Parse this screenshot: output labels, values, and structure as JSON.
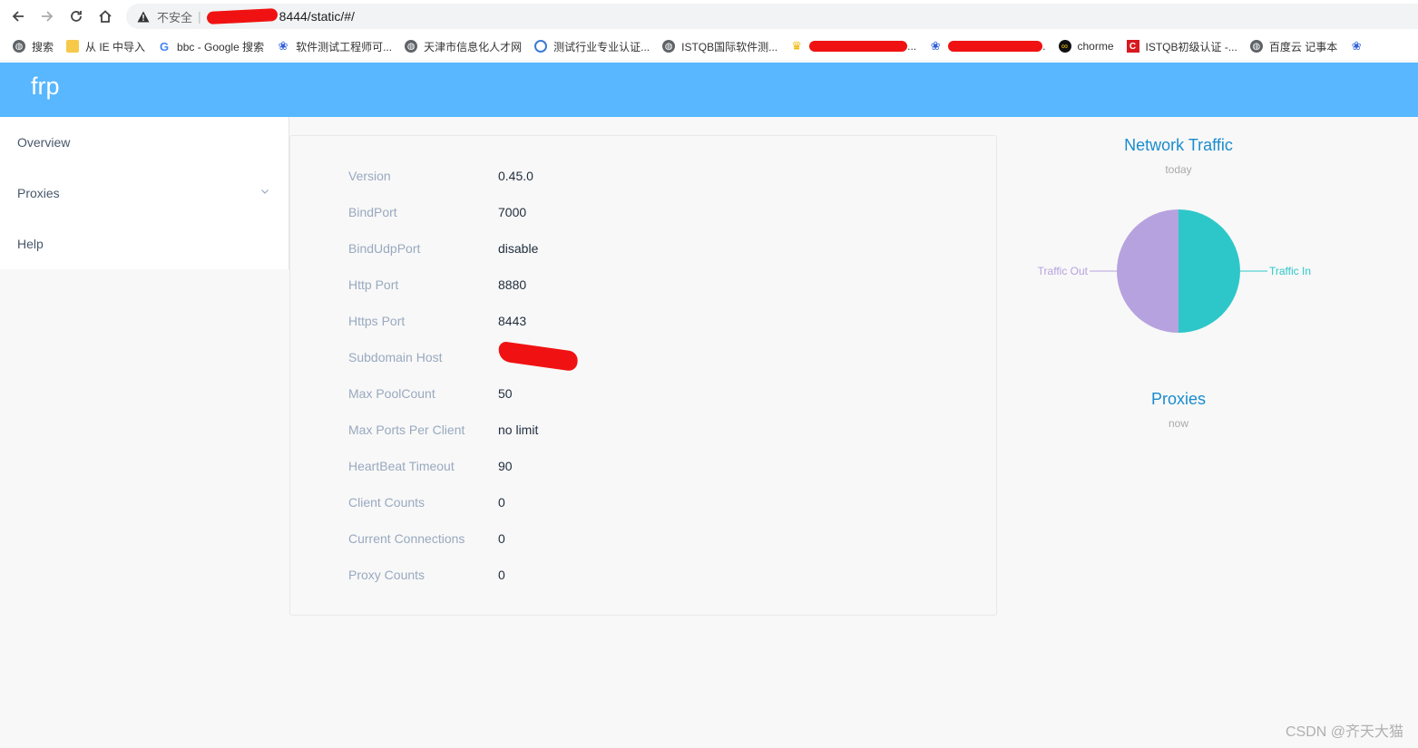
{
  "browser": {
    "insecure_label": "不安全",
    "url_visible": "8444/static/#/",
    "bookmarks": [
      "搜索",
      "从 IE 中导入",
      "bbc - Google 搜索",
      "软件测试工程师可...",
      "天津市信息化人才网",
      "测试行业专业认证...",
      "ISTQB国际软件测...",
      "...",
      ".",
      "chorme",
      "ISTQB初级认证 -...",
      "百度云 记事本"
    ]
  },
  "app": {
    "logo": "frp"
  },
  "sidebar": {
    "items": [
      {
        "label": "Overview"
      },
      {
        "label": "Proxies"
      },
      {
        "label": "Help"
      }
    ]
  },
  "server_info": [
    {
      "key": "Version",
      "value": "0.45.0"
    },
    {
      "key": "BindPort",
      "value": "7000"
    },
    {
      "key": "BindUdpPort",
      "value": "disable"
    },
    {
      "key": "Http Port",
      "value": "8880"
    },
    {
      "key": "Https Port",
      "value": "8443"
    },
    {
      "key": "Subdomain Host",
      "value": ""
    },
    {
      "key": "Max PoolCount",
      "value": "50"
    },
    {
      "key": "Max Ports Per Client",
      "value": "no limit"
    },
    {
      "key": "HeartBeat Timeout",
      "value": "90"
    },
    {
      "key": "Client Counts",
      "value": "0"
    },
    {
      "key": "Current Connections",
      "value": "0"
    },
    {
      "key": "Proxy Counts",
      "value": "0"
    }
  ],
  "traffic_chart": {
    "title": "Network Traffic",
    "subtitle": "today",
    "chart_data": {
      "type": "pie",
      "categories": [
        "Traffic In",
        "Traffic Out"
      ],
      "values": [
        50,
        50
      ],
      "colors": [
        "#2ec7c9",
        "#b6a2de"
      ]
    }
  },
  "proxies_chart": {
    "title": "Proxies",
    "subtitle": "now"
  },
  "watermark": "CSDN @齐天大猫"
}
